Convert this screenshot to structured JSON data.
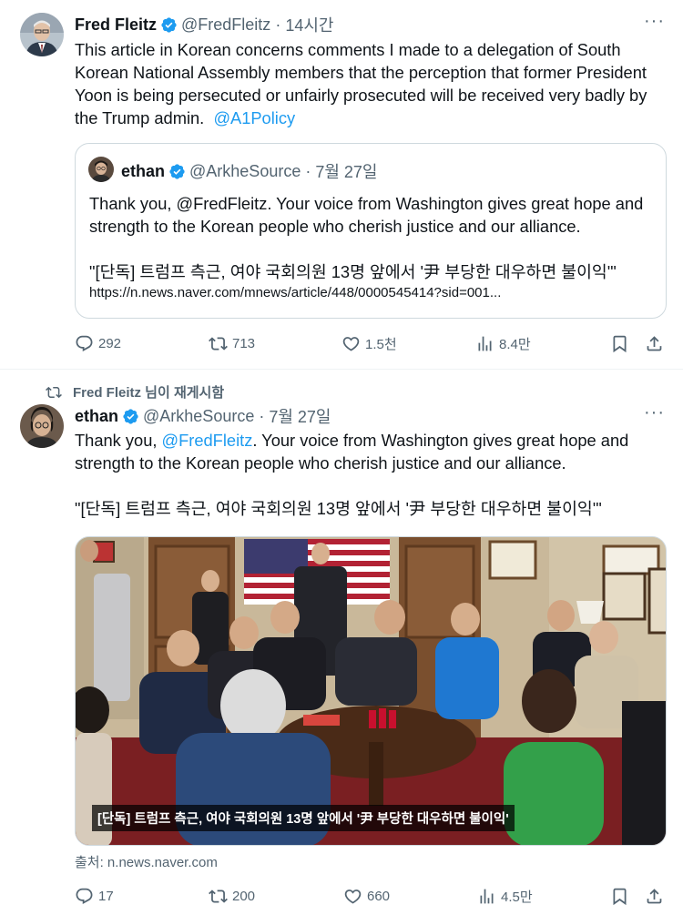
{
  "tweet1": {
    "author_name": "Fred Fleitz",
    "handle": "@FredFleitz",
    "separator": "·",
    "time": "14시간",
    "more_label": "···",
    "text": "This article in Korean concerns comments I made to a delegation of South Korean National Assembly members that the perception that former President Yoon is being persecuted or unfairly prosecuted will be received very badly by the Trump admin.",
    "mention": "@A1Policy",
    "quote": {
      "author_name": "ethan",
      "handle": "@ArkheSource",
      "separator": "·",
      "time": "7월 27일",
      "text": "Thank you, @FredFleitz. Your voice from Washington gives great hope and strength to the Korean people who cherish justice and our alliance.",
      "headline": "\"[단독] 트럼프 측근, 여야 국회의원 13명 앞에서 '尹 부당한 대우하면 불이익'\"",
      "url": "https://n.news.naver.com/mnews/article/448/0000545414?sid=001..."
    },
    "actions": {
      "replies": "292",
      "reposts": "713",
      "likes": "1.5천",
      "views": "8.4만"
    }
  },
  "tweet2": {
    "retweeted_by": "Fred Fleitz 님이 재게시함",
    "author_name": "ethan",
    "handle": "@ArkheSource",
    "separator": "·",
    "time": "7월 27일",
    "more_label": "···",
    "text_prefix": "Thank you, ",
    "mention": "@FredFleitz",
    "text_suffix": ". Your voice from Washington gives great hope and strength to the Korean people who cherish justice and our alliance.",
    "headline": "\"[단독] 트럼프 측근, 여야 국회의원 13명 앞에서 '尹 부당한 대우하면 불이익'\"",
    "image_caption": "[단독] 트럼프 측근, 여야 국회의원 13명 앞에서 '尹 부당한 대우하면 불이익'",
    "source": "출처: n.news.naver.com",
    "actions": {
      "replies": "17",
      "reposts": "200",
      "likes": "660",
      "views": "4.5만"
    }
  },
  "colors": {
    "text": "#0f1419",
    "secondary": "#536471",
    "link": "#1d9bf0",
    "verified": "#1d9bf0",
    "border": "#cfd9de"
  },
  "icons": [
    "verified-badge-icon",
    "reply-icon",
    "repost-icon",
    "like-icon",
    "views-icon",
    "bookmark-icon",
    "share-icon",
    "more-icon"
  ]
}
